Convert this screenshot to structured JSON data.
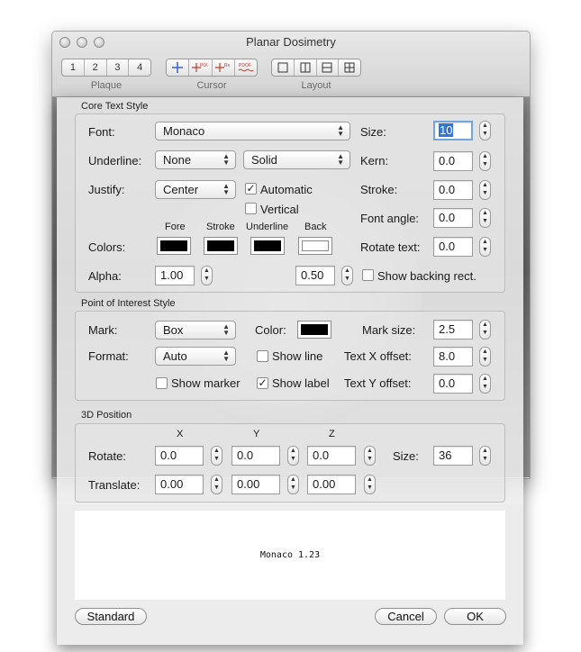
{
  "window": {
    "title": "Planar Dosimetry",
    "plaque": {
      "label": "Plaque",
      "segments": [
        "1",
        "2",
        "3",
        "4"
      ]
    },
    "cursor": {
      "label": "Cursor",
      "tools": [
        "crosshair-icon",
        "poi-icon",
        "rx-icon",
        "pdof-icon"
      ]
    },
    "layout": {
      "label": "Layout",
      "tools": [
        "layout-single-icon",
        "layout-columns-icon",
        "layout-rows-icon",
        "layout-grid-icon"
      ]
    }
  },
  "core_text": {
    "title": "Core Text Style",
    "font_label": "Font:",
    "font_value": "Monaco",
    "size_label": "Size:",
    "size_value": "10",
    "underline_label": "Underline:",
    "underline_value": "None",
    "underline_style_value": "Solid",
    "kern_label": "Kern:",
    "kern_value": "0.0",
    "justify_label": "Justify:",
    "justify_value": "Center",
    "automatic_label": "Automatic",
    "vertical_label": "Vertical",
    "stroke_label": "Stroke:",
    "stroke_value": "0.0",
    "font_angle_label": "Font angle:",
    "font_angle_value": "0.0",
    "color_headers": [
      "Fore",
      "Stroke",
      "Underline",
      "Back"
    ],
    "colors_label": "Colors:",
    "rotate_text_label": "Rotate text:",
    "rotate_text_value": "0.0",
    "alpha_label": "Alpha:",
    "alpha_value": "1.00",
    "back_alpha_value": "0.50",
    "show_backing_label": "Show backing rect.",
    "swatch_colors": [
      "#000000",
      "#000000",
      "#000000",
      "#ffffff"
    ]
  },
  "poi": {
    "title": "Point of Interest Style",
    "mark_label": "Mark:",
    "mark_value": "Box",
    "color_label": "Color:",
    "mark_color": "#000000",
    "mark_size_label": "Mark size:",
    "mark_size_value": "2.5",
    "format_label": "Format:",
    "format_value": "Auto",
    "show_line_label": "Show line",
    "text_x_label": "Text X offset:",
    "text_x_value": "8.0",
    "show_marker_label": "Show marker",
    "show_label_label": "Show label",
    "text_y_label": "Text Y offset:",
    "text_y_value": "0.0"
  },
  "position3d": {
    "title": "3D Position",
    "axes": [
      "X",
      "Y",
      "Z"
    ],
    "rotate_label": "Rotate:",
    "rotate_values": [
      "0.0",
      "0.0",
      "0.0"
    ],
    "size_label": "Size:",
    "size_value": "36",
    "translate_label": "Translate:",
    "translate_values": [
      "0.00",
      "0.00",
      "0.00"
    ]
  },
  "preview": {
    "text": "Monaco 1.23"
  },
  "buttons": {
    "standard": "Standard",
    "cancel": "Cancel",
    "ok": "OK"
  }
}
